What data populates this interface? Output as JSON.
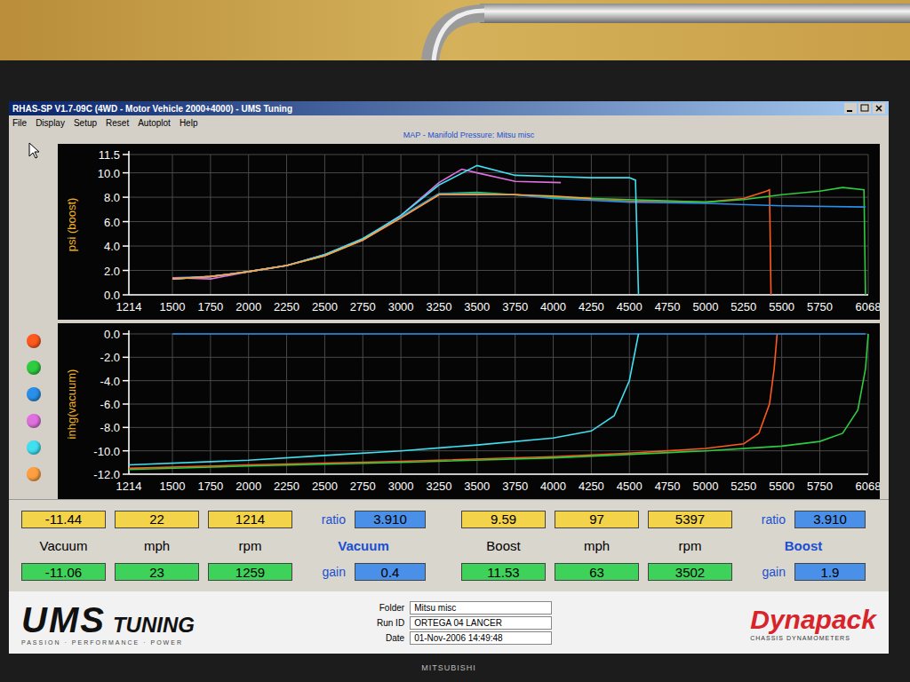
{
  "window": {
    "title": "RHAS-SP V1.7-09C (4WD - Motor Vehicle 2000+4000) - UMS Tuning"
  },
  "menu": [
    "File",
    "Display",
    "Setup",
    "Reset",
    "Autoplot",
    "Help"
  ],
  "chart": {
    "title": "MAP - Manifold Pressure: Mitsu misc",
    "x_ticks": [
      "1214",
      "1500",
      "1750",
      "2000",
      "2250",
      "2500",
      "2750",
      "3000",
      "3250",
      "3500",
      "3750",
      "4000",
      "4250",
      "4500",
      "4750",
      "5000",
      "5250",
      "5500",
      "5750",
      "6068"
    ],
    "boost": {
      "axis_title": "psi (boost)",
      "y_ticks": [
        "11.5",
        "10.0",
        "8.0",
        "6.0",
        "4.0",
        "2.0",
        "0.0"
      ]
    },
    "vacuum": {
      "axis_title": "inhg(vacuum)",
      "y_ticks": [
        "0.0",
        "-2.0",
        "-4.0",
        "-6.0",
        "-8.0",
        "-10.0",
        "-12.0"
      ]
    },
    "series": [
      {
        "color": "#ff5a1e",
        "boost": {
          "rpm": [
            1500,
            1750,
            2000,
            2250,
            2500,
            2750,
            3000,
            3250,
            3500,
            3750,
            4000,
            4500,
            5000,
            5250,
            5400,
            5420,
            5430
          ],
          "psi": [
            1.3,
            1.5,
            1.9,
            2.4,
            3.2,
            4.5,
            6.3,
            8.2,
            8.3,
            8.2,
            8.0,
            7.7,
            7.6,
            7.9,
            8.5,
            8.6,
            0.0
          ]
        },
        "vacuum": {
          "rpm": [
            1214,
            2000,
            3000,
            4000,
            4500,
            5000,
            5250,
            5350,
            5420,
            5450,
            5470
          ],
          "inhg": [
            -11.5,
            -11.2,
            -10.9,
            -10.5,
            -10.2,
            -9.8,
            -9.4,
            -8.5,
            -6.0,
            -3.0,
            0.0
          ]
        }
      },
      {
        "color": "#2ecc40",
        "boost": {
          "rpm": [
            1500,
            1750,
            2000,
            2250,
            2500,
            2750,
            3000,
            3250,
            3500,
            3750,
            4000,
            4500,
            5000,
            5250,
            5500,
            5750,
            5900,
            6040,
            6050
          ],
          "psi": [
            1.3,
            1.5,
            1.9,
            2.4,
            3.2,
            4.5,
            6.4,
            8.3,
            8.4,
            8.2,
            8.0,
            7.8,
            7.6,
            7.8,
            8.2,
            8.5,
            8.8,
            8.6,
            0.0
          ]
        },
        "vacuum": {
          "rpm": [
            1214,
            2000,
            3000,
            4000,
            5000,
            5500,
            5750,
            5900,
            6000,
            6050,
            6068
          ],
          "inhg": [
            -11.6,
            -11.3,
            -11.0,
            -10.6,
            -10.0,
            -9.6,
            -9.2,
            -8.5,
            -6.5,
            -3.0,
            0.0
          ]
        }
      },
      {
        "color": "#2a8fe8",
        "boost": {
          "rpm": [
            1500,
            1750,
            2000,
            2250,
            2500,
            2750,
            3000,
            3250,
            3500,
            3750,
            4000,
            4500,
            5000,
            5500,
            6050
          ],
          "psi": [
            1.4,
            1.5,
            1.9,
            2.4,
            3.3,
            4.6,
            6.4,
            8.3,
            8.3,
            8.2,
            7.9,
            7.6,
            7.5,
            7.3,
            7.2
          ]
        },
        "vacuum": {
          "rpm": [
            1500,
            6050
          ],
          "inhg": [
            0.0,
            0.0
          ]
        }
      },
      {
        "color": "#e070e0",
        "boost": {
          "rpm": [
            1500,
            1750,
            2000,
            2250,
            2500,
            2750,
            3000,
            3250,
            3400,
            3500,
            3750,
            4050
          ],
          "psi": [
            1.4,
            1.3,
            1.9,
            2.4,
            3.3,
            4.5,
            6.5,
            9.2,
            10.3,
            10.0,
            9.3,
            9.2
          ]
        },
        "vacuum": {
          "rpm": [],
          "inhg": []
        }
      },
      {
        "color": "#40e0f0",
        "boost": {
          "rpm": [
            1500,
            1750,
            2000,
            2250,
            2500,
            2750,
            3000,
            3250,
            3500,
            3750,
            4000,
            4250,
            4500,
            4540,
            4560
          ],
          "psi": [
            1.3,
            1.5,
            1.9,
            2.4,
            3.3,
            4.6,
            6.5,
            9.0,
            10.6,
            9.8,
            9.7,
            9.6,
            9.6,
            9.4,
            0.0
          ]
        },
        "vacuum": {
          "rpm": [
            1214,
            2000,
            2500,
            3000,
            3500,
            4000,
            4250,
            4400,
            4500,
            4560
          ],
          "inhg": [
            -11.2,
            -10.8,
            -10.4,
            -10.0,
            -9.5,
            -8.9,
            -8.3,
            -7.0,
            -4.0,
            0.0
          ]
        }
      },
      {
        "color": "#ffa040",
        "boost": {
          "rpm": [
            1500,
            1750,
            2000,
            2250,
            2500,
            2750,
            3000,
            3250,
            3500,
            3750,
            4000,
            4250
          ],
          "psi": [
            1.3,
            1.5,
            1.9,
            2.4,
            3.2,
            4.5,
            6.3,
            8.2,
            8.2,
            8.2,
            8.1,
            7.9
          ]
        },
        "vacuum": {
          "rpm": [],
          "inhg": []
        }
      }
    ]
  },
  "readouts": [
    {
      "title": "Vacuum",
      "labels": [
        "Vacuum",
        "mph",
        "rpm"
      ],
      "hold": [
        "-11.44",
        "22",
        "1214"
      ],
      "current": [
        "-11.06",
        "23",
        "1259"
      ],
      "ratio_label": "ratio",
      "ratio": "3.910",
      "gain_label": "gain",
      "gain": "0.4"
    },
    {
      "title": "Boost",
      "labels": [
        "Boost",
        "mph",
        "rpm"
      ],
      "hold": [
        "9.59",
        "97",
        "5397"
      ],
      "current": [
        "11.53",
        "63",
        "3502"
      ],
      "ratio_label": "ratio",
      "ratio": "3.910",
      "gain_label": "gain",
      "gain": "1.9"
    }
  ],
  "footer": {
    "logo": {
      "name": "UMS",
      "sub": "TUNING",
      "tagline": "PASSION · PERFORMANCE · POWER"
    },
    "info": [
      {
        "label": "Folder",
        "value": "Mitsu misc"
      },
      {
        "label": "Run ID",
        "value": "ORTEGA 04 LANCER"
      },
      {
        "label": "Date",
        "value": "01-Nov-2006 14:49:48"
      }
    ],
    "brand": {
      "name": "Dynapack",
      "tagline": "CHASSIS DYNAMOMETERS"
    }
  },
  "monitor": {
    "brand": "MITSUBISHI"
  }
}
